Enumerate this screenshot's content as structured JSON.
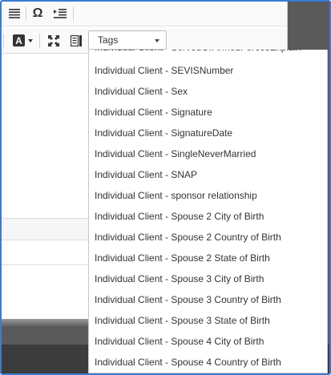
{
  "toolbar": {
    "tags_label": "Tags",
    "icons": [
      "align-justify-icon",
      "omega-icon",
      "list-indent-icon",
      "font-color-icon",
      "fullscreen-icon",
      "show-blocks-icon"
    ]
  },
  "dropdown": {
    "partial_item": "Individual Client - ServedOrArmedForcesExplain",
    "items": [
      "Individual Client - SEVISNumber",
      "Individual Client - Sex",
      "Individual Client - Signature",
      "Individual Client - SignatureDate",
      "Individual Client - SingleNeverMarried",
      "Individual Client - SNAP",
      "Individual Client - sponsor relationship",
      "Individual Client - Spouse 2 City of Birth",
      "Individual Client - Spouse 2 Country of Birth",
      "Individual Client - Spouse 2 State of Birth",
      "Individual Client - Spouse 3 City of Birth",
      "Individual Client - Spouse 3 Country of Birth",
      "Individual Client - Spouse 3 State of Birth",
      "Individual Client - Spouse 4 City of Birth",
      "Individual Client - Spouse 4 Country of Birth"
    ]
  }
}
